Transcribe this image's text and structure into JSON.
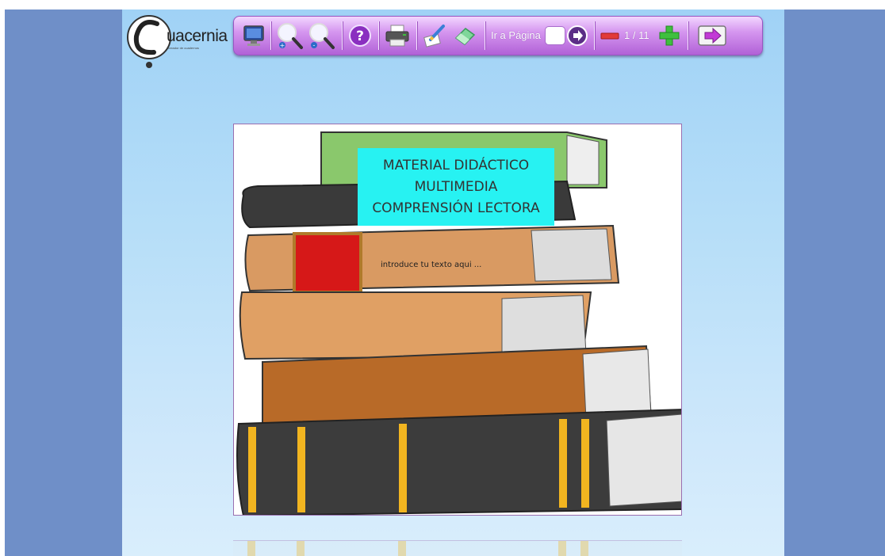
{
  "logo": {
    "text": "uacernia",
    "tagline": "creador de cuadernos"
  },
  "toolbar": {
    "ir_label": "Ir a Página",
    "page_input_value": "",
    "page_count": "1 / 11"
  },
  "page": {
    "title_lines": [
      "MATERIAL DIDÁCTICO",
      "MULTIMEDIA",
      "COMPRENSIÓN LECTORA"
    ],
    "intro_text": "introduce tu texto aqui ..."
  },
  "colors": {
    "sidebar": "#6f8fc8",
    "toolbar_accent": "#b161d7",
    "title_box": "#27f2f2"
  },
  "icons": [
    "monitor-icon",
    "zoom-in-icon",
    "zoom-out-icon",
    "help-icon",
    "print-icon",
    "edit-icon",
    "eraser-icon",
    "go-arrow-icon",
    "minus-icon",
    "plus-icon",
    "exit-icon"
  ]
}
